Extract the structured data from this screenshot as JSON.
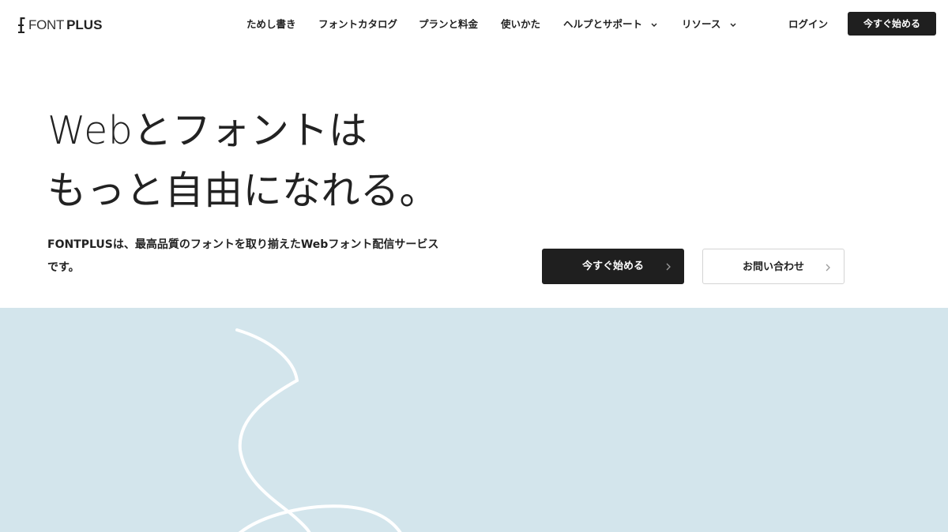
{
  "brand": {
    "logo_light": "FONT",
    "logo_bold": "PLUS"
  },
  "nav": {
    "items": [
      {
        "label": "ためし書き"
      },
      {
        "label": "フォントカタログ"
      },
      {
        "label": "プランと料金"
      },
      {
        "label": "使いかた"
      },
      {
        "label": "ヘルプとサポート"
      },
      {
        "label": "リソース"
      }
    ],
    "login_label": "ログイン",
    "start_label": "今すぐ始める"
  },
  "hero": {
    "title_line1": "Webとフォントは",
    "title_line2": "もっと自由になれる。",
    "description_line1": "FONTPLUSは、最高品質のフォントを取り揃えたWebフォント配信サービス",
    "description_line2": "です。",
    "cta_primary": "今すぐ始める",
    "cta_secondary": "お問い合わせ"
  },
  "colors": {
    "dark": "#1f1f1f",
    "accent_bg": "#d3e5ec",
    "white": "#ffffff"
  },
  "icons": {
    "dropdown": "chevron-down-icon",
    "arrow": "chevron-right-icon"
  }
}
